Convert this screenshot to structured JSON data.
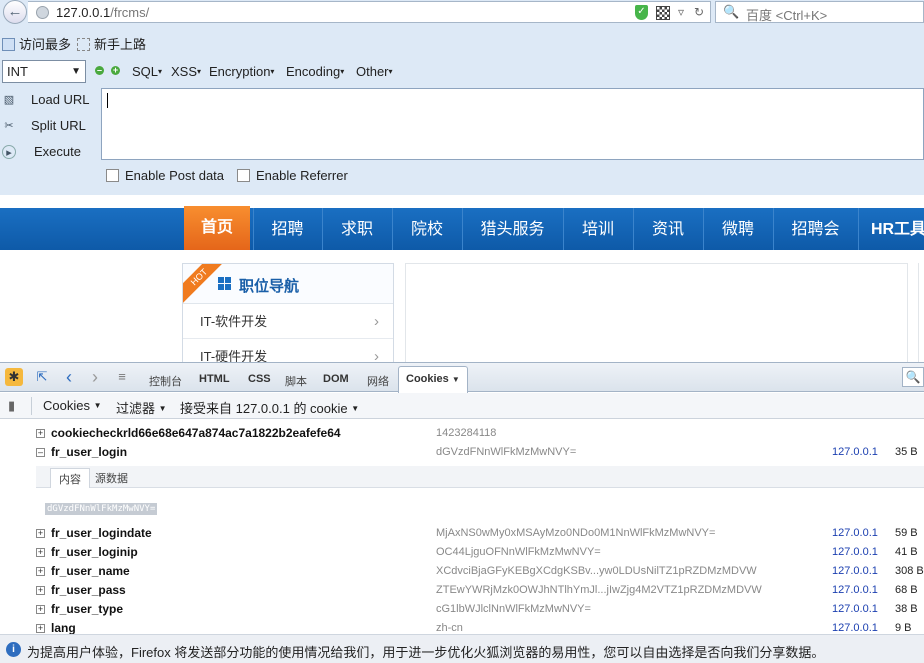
{
  "browser": {
    "url_host": "127.0.0.1",
    "url_path": "/frcms/",
    "search_placeholder": "百度 <Ctrl+K>",
    "bookmarks": [
      "访问最多",
      "新手上路"
    ]
  },
  "hackbar": {
    "select_value": "INT",
    "menus": [
      "SQL",
      "XSS",
      "Encryption",
      "Encoding",
      "Other"
    ],
    "side_buttons": [
      "Load URL",
      "Split URL",
      "Execute"
    ],
    "url_value": "",
    "checkboxes": [
      "Enable Post data",
      "Enable Referrer"
    ]
  },
  "site": {
    "nav": [
      "首页",
      "招聘",
      "求职",
      "院校",
      "猎头服务",
      "培训",
      "资讯",
      "微聘",
      "招聘会",
      "HR工具"
    ],
    "hot_badge": "HOT",
    "job_nav_title": "职位导航",
    "job_nav_items": [
      "IT-软件开发",
      "IT-硬件开发"
    ]
  },
  "firebug": {
    "tabs": [
      "控制台",
      "HTML",
      "CSS",
      "脚本",
      "DOM",
      "网络",
      "Cookies"
    ],
    "toolbar": {
      "cookies": "Cookies",
      "filter": "过滤器",
      "accept": "接受来自 127.0.0.1 的 cookie"
    },
    "cookies": [
      {
        "name": "cookiecheckrld66e68e647a874ac7a1822b2eafefe64",
        "value": "1423284118",
        "domain": "",
        "size": "",
        "expanded": false
      },
      {
        "name": "fr_user_login",
        "value": "dGVzdFNnWlFkMzMwNVY=",
        "domain": "127.0.0.1",
        "size": "35 B",
        "expanded": true
      },
      {
        "name": "fr_user_logindate",
        "value": "MjAxNS0wMy0xMSAyMzo0NDo0M1NnWlFkMzMwNVY=",
        "domain": "127.0.0.1",
        "size": "59 B",
        "expanded": false
      },
      {
        "name": "fr_user_loginip",
        "value": "OC44LjguOFNnWlFkMzMwNVY=",
        "domain": "127.0.0.1",
        "size": "41 B",
        "expanded": false
      },
      {
        "name": "fr_user_name",
        "value": "XCdvciBjaGFyKEBgXCdgKSBv...yw0LDUsNilTZ1pRZDMzMDVW",
        "domain": "127.0.0.1",
        "size": "308 B",
        "expanded": false
      },
      {
        "name": "fr_user_pass",
        "value": "ZTEwYWRjMzk0OWJhNTlhYmJl...jIwZjg4M2VTZ1pRZDMzMDVW",
        "domain": "127.0.0.1",
        "size": "68 B",
        "expanded": false
      },
      {
        "name": "fr_user_type",
        "value": "cG1lbWJlclNnWlFkMzMwNVY=",
        "domain": "127.0.0.1",
        "size": "38 B",
        "expanded": false
      },
      {
        "name": "lang",
        "value": "zh-cn",
        "domain": "127.0.0.1",
        "size": "9 B",
        "expanded": false
      }
    ],
    "detail_tabs": [
      "内容",
      "源数据"
    ],
    "detail_value": "dGVzdFNnWlFkMzMwNVY="
  },
  "notification": "为提高用户体验，Firefox 将发送部分功能的使用情况给我们，用于进一步优化火狐浏览器的易用性，您可以自由选择是否向我们分享数据。"
}
